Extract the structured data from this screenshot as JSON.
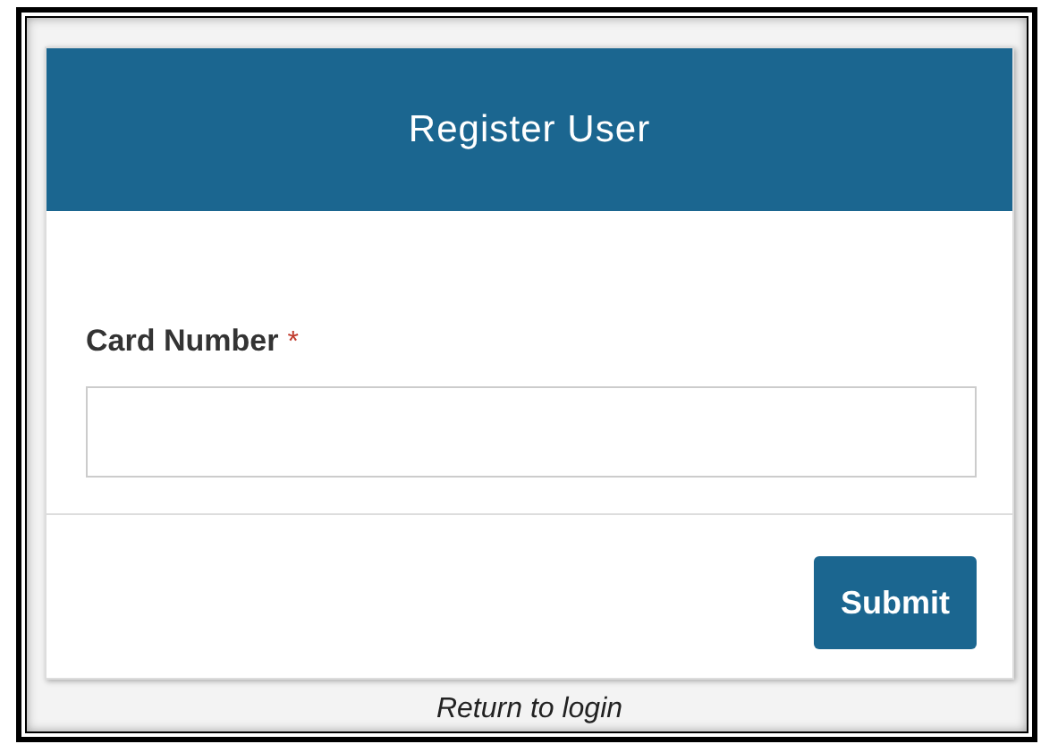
{
  "card": {
    "title": "Register User",
    "field": {
      "label": "Card Number",
      "required_mark": "*"
    },
    "submit": "Submit"
  },
  "return_link": "Return to login"
}
